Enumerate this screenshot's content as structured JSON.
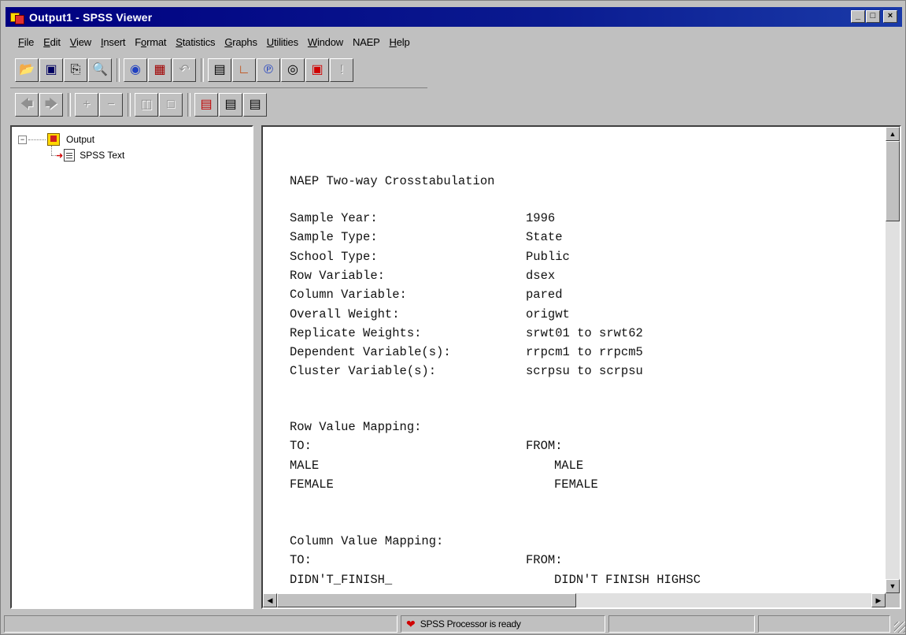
{
  "window": {
    "title": "Output1 - SPSS Viewer",
    "controls": {
      "minimize": "_",
      "maximize": "□",
      "close": "×"
    }
  },
  "menubar": [
    {
      "label": "File",
      "u": "F",
      "rest": "ile"
    },
    {
      "label": "Edit",
      "u": "E",
      "rest": "dit"
    },
    {
      "label": "View",
      "u": "V",
      "rest": "iew"
    },
    {
      "label": "Insert",
      "u": "I",
      "rest": "nsert"
    },
    {
      "label": "Format",
      "pre": "F",
      "u": "o",
      "rest": "rmat"
    },
    {
      "label": "Statistics",
      "u": "S",
      "rest": "tatistics"
    },
    {
      "label": "Graphs",
      "u": "G",
      "rest": "raphs"
    },
    {
      "label": "Utilities",
      "u": "U",
      "rest": "tilities"
    },
    {
      "label": "Window",
      "u": "W",
      "rest": "indow"
    },
    {
      "label": "NAEP",
      "u": "",
      "rest": "NAEP"
    },
    {
      "label": "Help",
      "u": "H",
      "rest": "elp"
    }
  ],
  "toolbar1": [
    "open-icon",
    "save-icon",
    "print-icon",
    "print-preview-icon",
    "export-icon",
    "goto-data-icon",
    "undo-icon",
    "variables-icon",
    "goto-chart-icon",
    "variable-info-icon",
    "use-sets-icon",
    "select-last-output-icon",
    "designate-window-icon"
  ],
  "toolbar2": [
    "promote-icon",
    "demote-icon",
    "expand-icon",
    "collapse-icon",
    "show-icon",
    "hide-icon",
    "insert-heading-icon",
    "insert-title-icon",
    "insert-text-icon"
  ],
  "outline": {
    "root_label": "Output",
    "child_label": "SPSS Text",
    "expander": "−"
  },
  "output": {
    "heading": "NAEP Two-way Crosstabulation",
    "params": [
      {
        "label": "Sample Year:",
        "value": "1996"
      },
      {
        "label": "Sample Type:",
        "value": "State"
      },
      {
        "label": "School Type:",
        "value": "Public"
      },
      {
        "label": "Row Variable:",
        "value": "dsex"
      },
      {
        "label": "Column Variable:",
        "value": "pared"
      },
      {
        "label": "Overall Weight:",
        "value": "origwt"
      },
      {
        "label": "Replicate Weights:",
        "value": "srwt01 to srwt62"
      },
      {
        "label": "Dependent Variable(s):",
        "value": "rrpcm1 to rrpcm5"
      },
      {
        "label": "Cluster Variable(s):",
        "value": "scrpsu to scrpsu"
      }
    ],
    "row_mapping": {
      "title": "Row Value Mapping:",
      "to_header": "TO:",
      "from_header": "FROM:",
      "rows": [
        {
          "to": "MALE",
          "from": "MALE"
        },
        {
          "to": "FEMALE",
          "from": "FEMALE"
        }
      ]
    },
    "col_mapping": {
      "title": "Column Value Mapping:",
      "to_header": "TO:",
      "from_header": "FROM:",
      "rows": [
        {
          "to": "DIDN'T_FINISH_",
          "from": "DIDN'T FINISH HIGHSC"
        }
      ]
    }
  },
  "statusbar": {
    "text": "SPSS Processor is ready"
  },
  "colors": {
    "titlebar": "#000080",
    "face": "#c0c0c0"
  }
}
